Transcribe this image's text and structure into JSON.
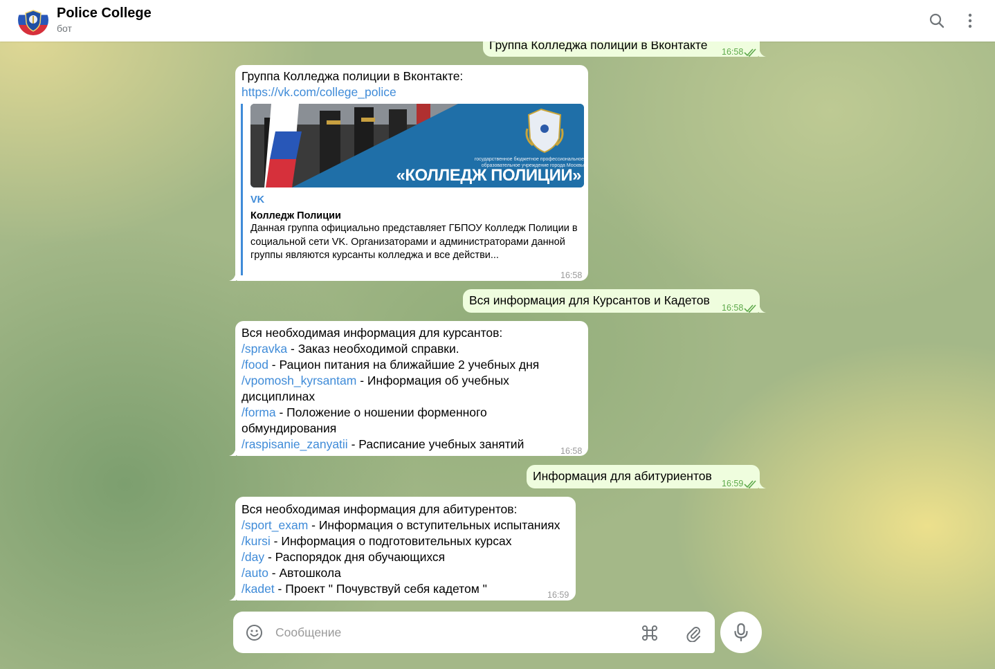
{
  "header": {
    "title": "Police College",
    "subtitle": "бот",
    "icons": [
      "search-icon",
      "more-vertical-icon"
    ]
  },
  "messages": {
    "m0": {
      "text": "Группа Колледжа полиции в Вконтакте",
      "time": "16:58"
    },
    "m1": {
      "text_line1": "Группа Колледжа полиции в Вконтакте:",
      "link": "https://vk.com/college_police",
      "preview": {
        "image_caption_small": "государственное бюджетное профессиональное образовательное учреждение города Москвы",
        "image_caption_big": "«КОЛЛЕДЖ ПОЛИЦИИ»",
        "site": "VK",
        "title": "Колледж Полиции",
        "description": "Данная группа официально представляет ГБПОУ Колледж Полиции в социальной сети VK. Организаторами и администраторами данной группы являются курсанты колледжа и все действи..."
      },
      "time": "16:58"
    },
    "m2": {
      "text": "Вся информация для Курсантов и Кадетов",
      "time": "16:58"
    },
    "m3": {
      "intro": "Вся необходимая информация для курсантов:",
      "items": [
        {
          "cmd": "/spravka",
          "desc": " - Заказ необходимой справки."
        },
        {
          "cmd": "/food",
          "desc": " - Рацион питания на ближайшие 2 учебных дня"
        },
        {
          "cmd": "/vpomosh_kyrsantam",
          "desc": " - Информация об учебных",
          "desc2": "дисциплинах"
        },
        {
          "cmd": "/forma",
          "desc": " - Положение о ношении форменного",
          "desc2": "обмундирования"
        },
        {
          "cmd": "/raspisanie_zanyatii",
          "desc": " - Расписание учебных занятий"
        }
      ],
      "time": "16:58"
    },
    "m4": {
      "text": "Информация для абитуриентов",
      "time": "16:59"
    },
    "m5": {
      "intro": "Вся необходимая информация для абитурентов:",
      "items": [
        {
          "cmd": "/sport_exam",
          "desc": " - Информация о вступительных испытаниях"
        },
        {
          "cmd": "/kursi",
          "desc": " - Информация о подготовительных курсах"
        },
        {
          "cmd": "/day",
          "desc": " - Распорядок дня обучающихся"
        },
        {
          "cmd": "/auto",
          "desc": " - Автошкола"
        },
        {
          "cmd": "/kadet",
          "desc": " - Проект \" Почувствуй себя кадетом \""
        }
      ],
      "time": "16:59"
    }
  },
  "composer": {
    "placeholder": "Сообщение",
    "icons": [
      "emoji-icon",
      "bot-commands-icon",
      "attach-icon",
      "microphone-icon"
    ]
  },
  "colors": {
    "accent": "#3f8bd8",
    "outgoing_bubble": "#effdde",
    "incoming_bubble": "#ffffff",
    "read_check": "#5ea94b"
  }
}
